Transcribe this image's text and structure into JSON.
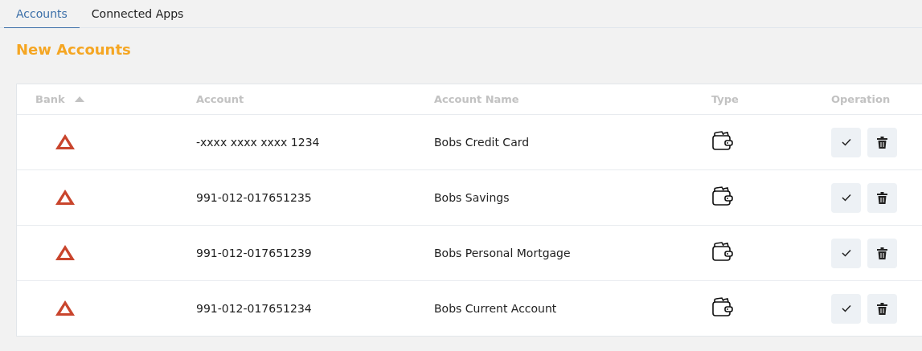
{
  "tabs": [
    {
      "label": "Accounts",
      "selected": true
    },
    {
      "label": "Connected Apps",
      "selected": false
    }
  ],
  "section_title": "New Accounts",
  "table": {
    "columns": [
      {
        "label": "Bank",
        "sorted": true
      },
      {
        "label": "Account",
        "sorted": false
      },
      {
        "label": "Account Name",
        "sorted": false
      },
      {
        "label": "Type",
        "sorted": false
      },
      {
        "label": "Operation",
        "sorted": false
      }
    ],
    "rows": [
      {
        "account": "-xxxx xxxx xxxx 1234",
        "account_name": "Bobs Credit Card"
      },
      {
        "account": "991-012-017651235",
        "account_name": "Bobs Savings"
      },
      {
        "account": "991-012-017651239",
        "account_name": "Bobs Personal Mortgage"
      },
      {
        "account": "991-012-017651234",
        "account_name": "Bobs Current Account"
      }
    ]
  }
}
